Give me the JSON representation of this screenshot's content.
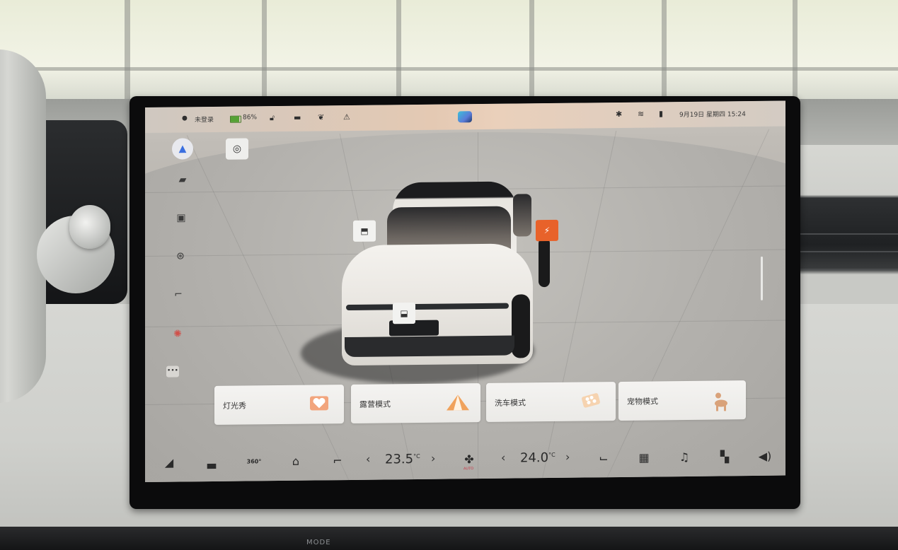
{
  "status_bar": {
    "login": "未登录",
    "battery": "86%",
    "datetime": "9月19日 星期四 15:24",
    "icons": [
      "person-icon",
      "battery-icon",
      "lock-icon",
      "sunroof-icon",
      "leaf-icon",
      "alert-icon",
      "bluetooth-icon",
      "wifi-icon",
      "signal-icon",
      "app-logo-icon"
    ]
  },
  "left_rail": {
    "icons": [
      "navigation-icon",
      "car-front-icon",
      "hud-icon",
      "steering-icon",
      "seat-icon",
      "light-icon",
      "more-icon"
    ],
    "more": "•••"
  },
  "car_view": {
    "hotspots": [
      "door-icon",
      "trunk-icon",
      "frunk-icon",
      "charge-port-icon"
    ]
  },
  "modes": [
    {
      "label": "灯光秀",
      "icon": "lightshow-icon"
    },
    {
      "label": "露营模式",
      "icon": "tent-icon"
    },
    {
      "label": "洗车模式",
      "icon": "carwash-icon"
    },
    {
      "label": "宠物模式",
      "icon": "pet-icon"
    }
  ],
  "dock": {
    "left_temp": "23.5",
    "right_temp": "24.0",
    "temp_unit": "°C",
    "fan_label": "AUTO",
    "cam_label": "360°",
    "icons": [
      "home-icon",
      "car-icon",
      "camera-360-icon",
      "defrost-front-icon",
      "seat-left-icon",
      "fan-icon",
      "seat-right-icon",
      "defrost-rear-icon",
      "music-icon",
      "apps-icon",
      "volume-icon"
    ]
  },
  "console": {
    "mode_label": "MODE"
  },
  "colors": {
    "accent": "#e8622a",
    "battery": "#55a235",
    "nav": "#3b6fe0"
  }
}
